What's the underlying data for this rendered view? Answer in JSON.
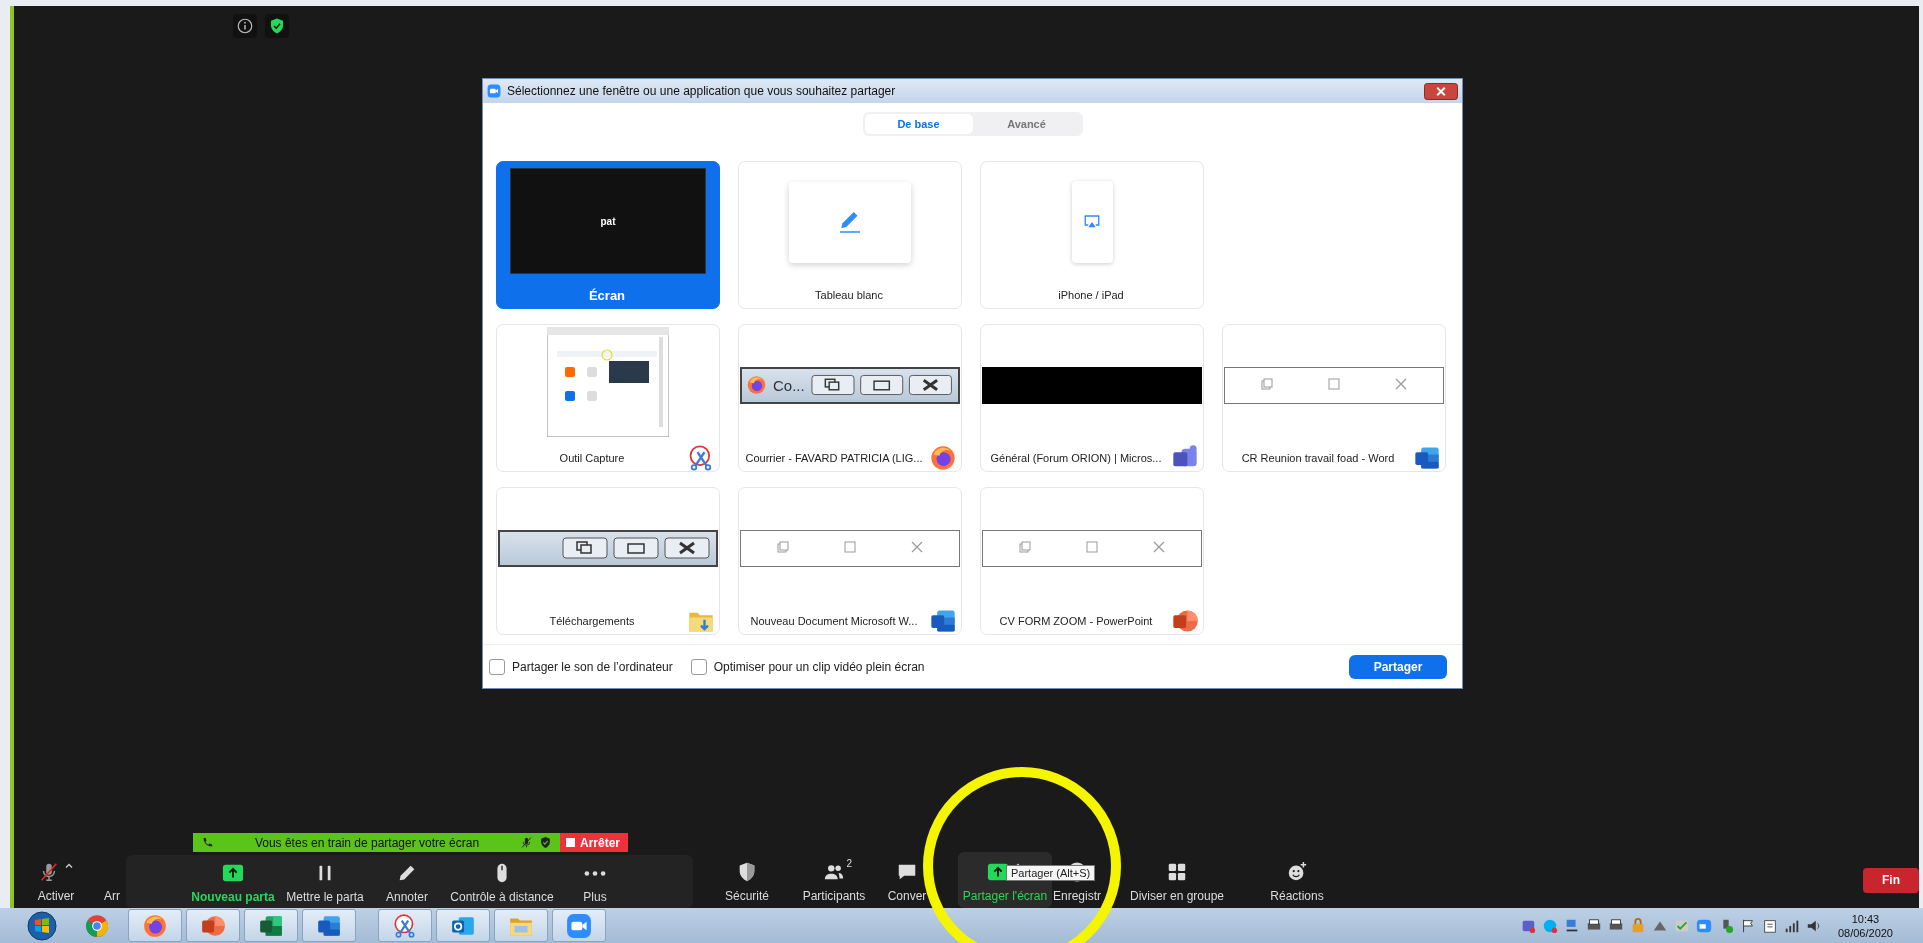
{
  "dialog": {
    "title": "Sélectionnez une fenêtre ou une application que vous souhaitez partager",
    "tabs": [
      {
        "label": "De base",
        "selected": true
      },
      {
        "label": "Avancé",
        "selected": false
      }
    ],
    "rows": [
      [
        {
          "label": "Écran",
          "kind": "screen",
          "selected": true,
          "thumb_text": "pat"
        },
        {
          "label": "Tableau blanc",
          "kind": "whiteboard",
          "selected": false
        },
        {
          "label": "iPhone / iPad",
          "kind": "device",
          "selected": false
        }
      ],
      [
        {
          "label": "Outil Capture",
          "kind": "capture",
          "selected": false
        },
        {
          "label": "Courrier - FAVARD PATRICIA (LIG...",
          "kind": "classic",
          "selected": false,
          "thumb_text": "Co..."
        },
        {
          "label": "Général (Forum ORION) | Micros...",
          "kind": "black",
          "selected": false
        },
        {
          "label": "CR Reunion travail foad - Word",
          "kind": "flat",
          "selected": false
        }
      ],
      [
        {
          "label": "Téléchargements",
          "kind": "classic",
          "selected": false
        },
        {
          "label": "Nouveau Document Microsoft W...",
          "kind": "flat",
          "selected": false
        },
        {
          "label": "CV FORM ZOOM - PowerPoint",
          "kind": "flat",
          "selected": false
        }
      ]
    ],
    "options": [
      {
        "label": "Partager le son de l’ordinateur",
        "checked": false
      },
      {
        "label": "Optimiser pour un clip vidéo plein écran",
        "checked": false
      }
    ],
    "share_button": "Partager"
  },
  "sharing_banner": {
    "text": "Vous êtes en train de partager votre écran",
    "stop_button": "Arrêter"
  },
  "toolbar": {
    "audio": {
      "label": "Activer",
      "muted": true
    },
    "video_label": "Arr",
    "share_menu": [
      {
        "label": "Nouveau parta",
        "active": true
      },
      {
        "label": "Mettre le parta",
        "active": false
      },
      {
        "label": "Annoter",
        "active": false
      },
      {
        "label": "Contrôle à distance",
        "active": false
      },
      {
        "label": "Plus",
        "active": false
      }
    ],
    "items": [
      {
        "label": "Sécurité",
        "selected": false
      },
      {
        "label": "Participants",
        "count": "2",
        "selected": false
      },
      {
        "label": "Conver",
        "selected": false
      },
      {
        "label": "Partager l'écran",
        "selected": true
      },
      {
        "label": "Enregistr",
        "selected": false
      },
      {
        "label": "Diviser en groupe",
        "selected": false
      },
      {
        "label": "Réactions",
        "selected": false
      }
    ],
    "end_button": "Fin"
  },
  "tooltip": "Partager (Alt+S)",
  "taskbar": {
    "apps": [
      {
        "open": false
      },
      {
        "open": true
      },
      {
        "open": true
      },
      {
        "open": true
      },
      {
        "open": true
      },
      {
        "open": true
      },
      {
        "open": true
      },
      {
        "open": true
      },
      {
        "open": true
      }
    ],
    "time": "10:43",
    "date": "08/06/2020"
  }
}
